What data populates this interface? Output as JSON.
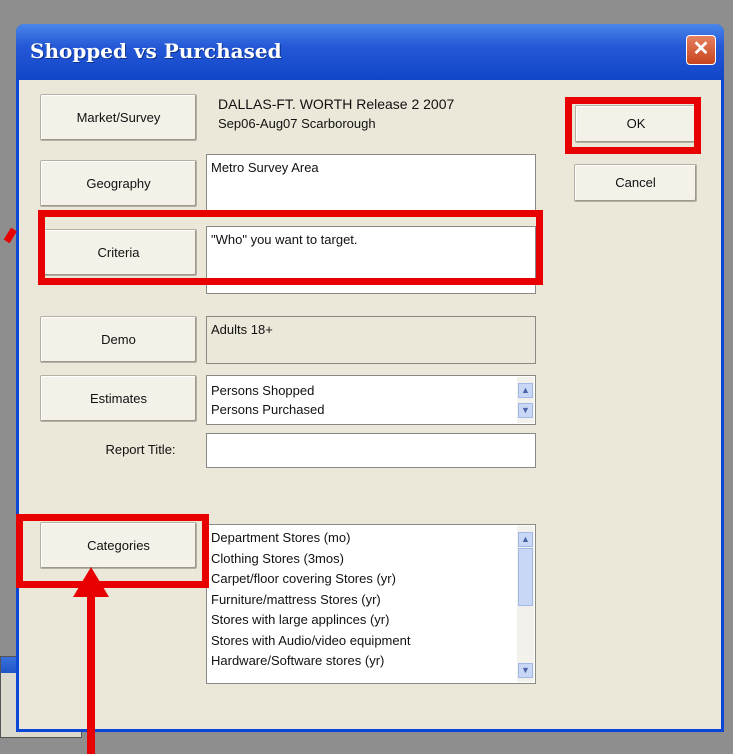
{
  "dialog": {
    "title": "Shopped vs Purchased",
    "close_glyph": "✕"
  },
  "buttons": {
    "market_survey": "Market/Survey",
    "geography": "Geography",
    "criteria": "Criteria",
    "demo": "Demo",
    "estimates": "Estimates",
    "categories": "Categories",
    "ok": "OK",
    "cancel": "Cancel"
  },
  "market": {
    "line1": "DALLAS-FT. WORTH Release 2 2007",
    "line2": "Sep06-Aug07 Scarborough"
  },
  "geography": {
    "value": "Metro Survey Area"
  },
  "criteria": {
    "value": "\"Who\" you want to target."
  },
  "demo": {
    "value": "Adults 18+"
  },
  "estimates": {
    "items": [
      "Persons Shopped",
      "Persons Purchased"
    ]
  },
  "report_title": {
    "label": "Report Title:",
    "value": ""
  },
  "categories": {
    "items": [
      "Department Stores (mo)",
      "Clothing Stores (3mos)",
      "Carpet/floor covering Stores (yr)",
      "Furniture/mattress Stores (yr)",
      "Stores with large applinces (yr)",
      "Stores with Audio/video equipment",
      "Hardware/Software stores (yr)"
    ]
  },
  "icons": {
    "scroll_up": "chevron-up-icon",
    "scroll_down": "chevron-down-icon",
    "close": "close-icon"
  },
  "colors": {
    "titlebar": "#1146c9",
    "dialog_bg": "#ebe7d9",
    "highlight": "#e80000"
  }
}
